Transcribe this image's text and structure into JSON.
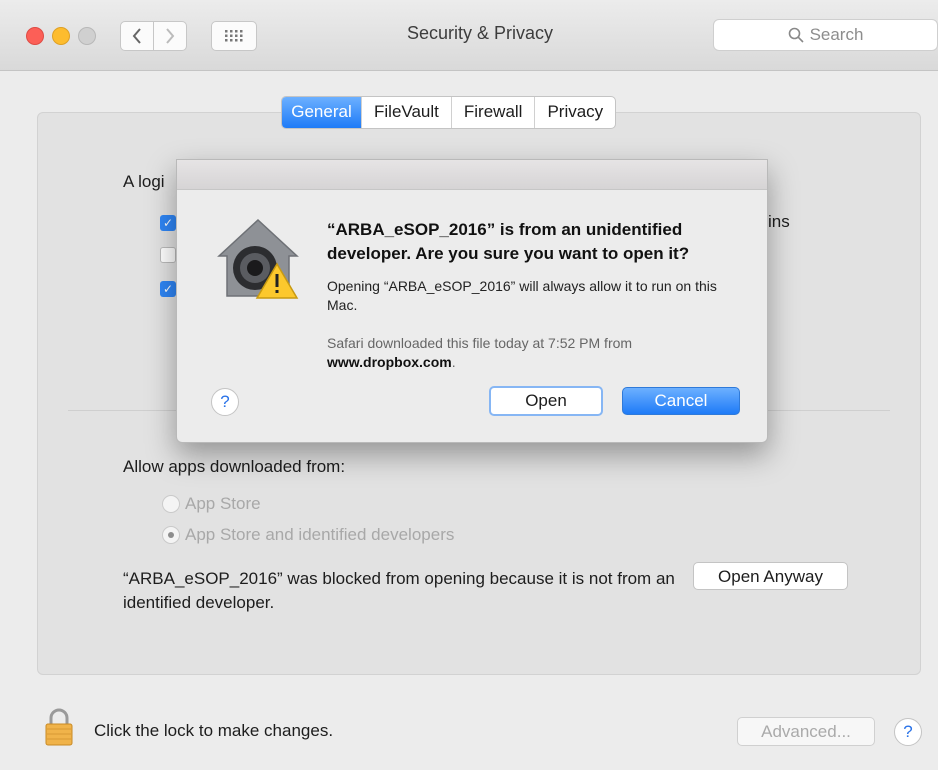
{
  "window": {
    "title": "Security & Privacy",
    "search_placeholder": "Search"
  },
  "tabs": [
    {
      "label": "General",
      "active": true
    },
    {
      "label": "FileVault",
      "active": false
    },
    {
      "label": "Firewall",
      "active": false
    },
    {
      "label": "Privacy",
      "active": false
    }
  ],
  "behind": {
    "text": "A logi",
    "suffix": "ins"
  },
  "allow": {
    "label": "Allow apps downloaded from:",
    "options": [
      {
        "label": "App Store",
        "selected": false
      },
      {
        "label": "App Store and identified developers",
        "selected": true
      }
    ]
  },
  "blocked": {
    "message": "“ARBA_eSOP_2016” was blocked from opening because it is not from an identified developer.",
    "button": "Open Anyway"
  },
  "footer": {
    "lock_text": "Click the lock to make changes.",
    "advanced": "Advanced...",
    "help": "?"
  },
  "dialog": {
    "title": "“ARBA_eSOP_2016” is from an unidentified developer. Are you sure you want to open it?",
    "message": "Opening “ARBA_eSOP_2016” will always allow it to run on this Mac.",
    "info_prefix": "Safari downloaded this file today at 7:52 PM from",
    "info_site": "www.dropbox.com",
    "info_suffix": ".",
    "open": "Open",
    "cancel": "Cancel",
    "help": "?"
  },
  "colors": {
    "accent": "#1e7bf7",
    "red": "#fc5f57",
    "yellow": "#fdbc2e"
  }
}
